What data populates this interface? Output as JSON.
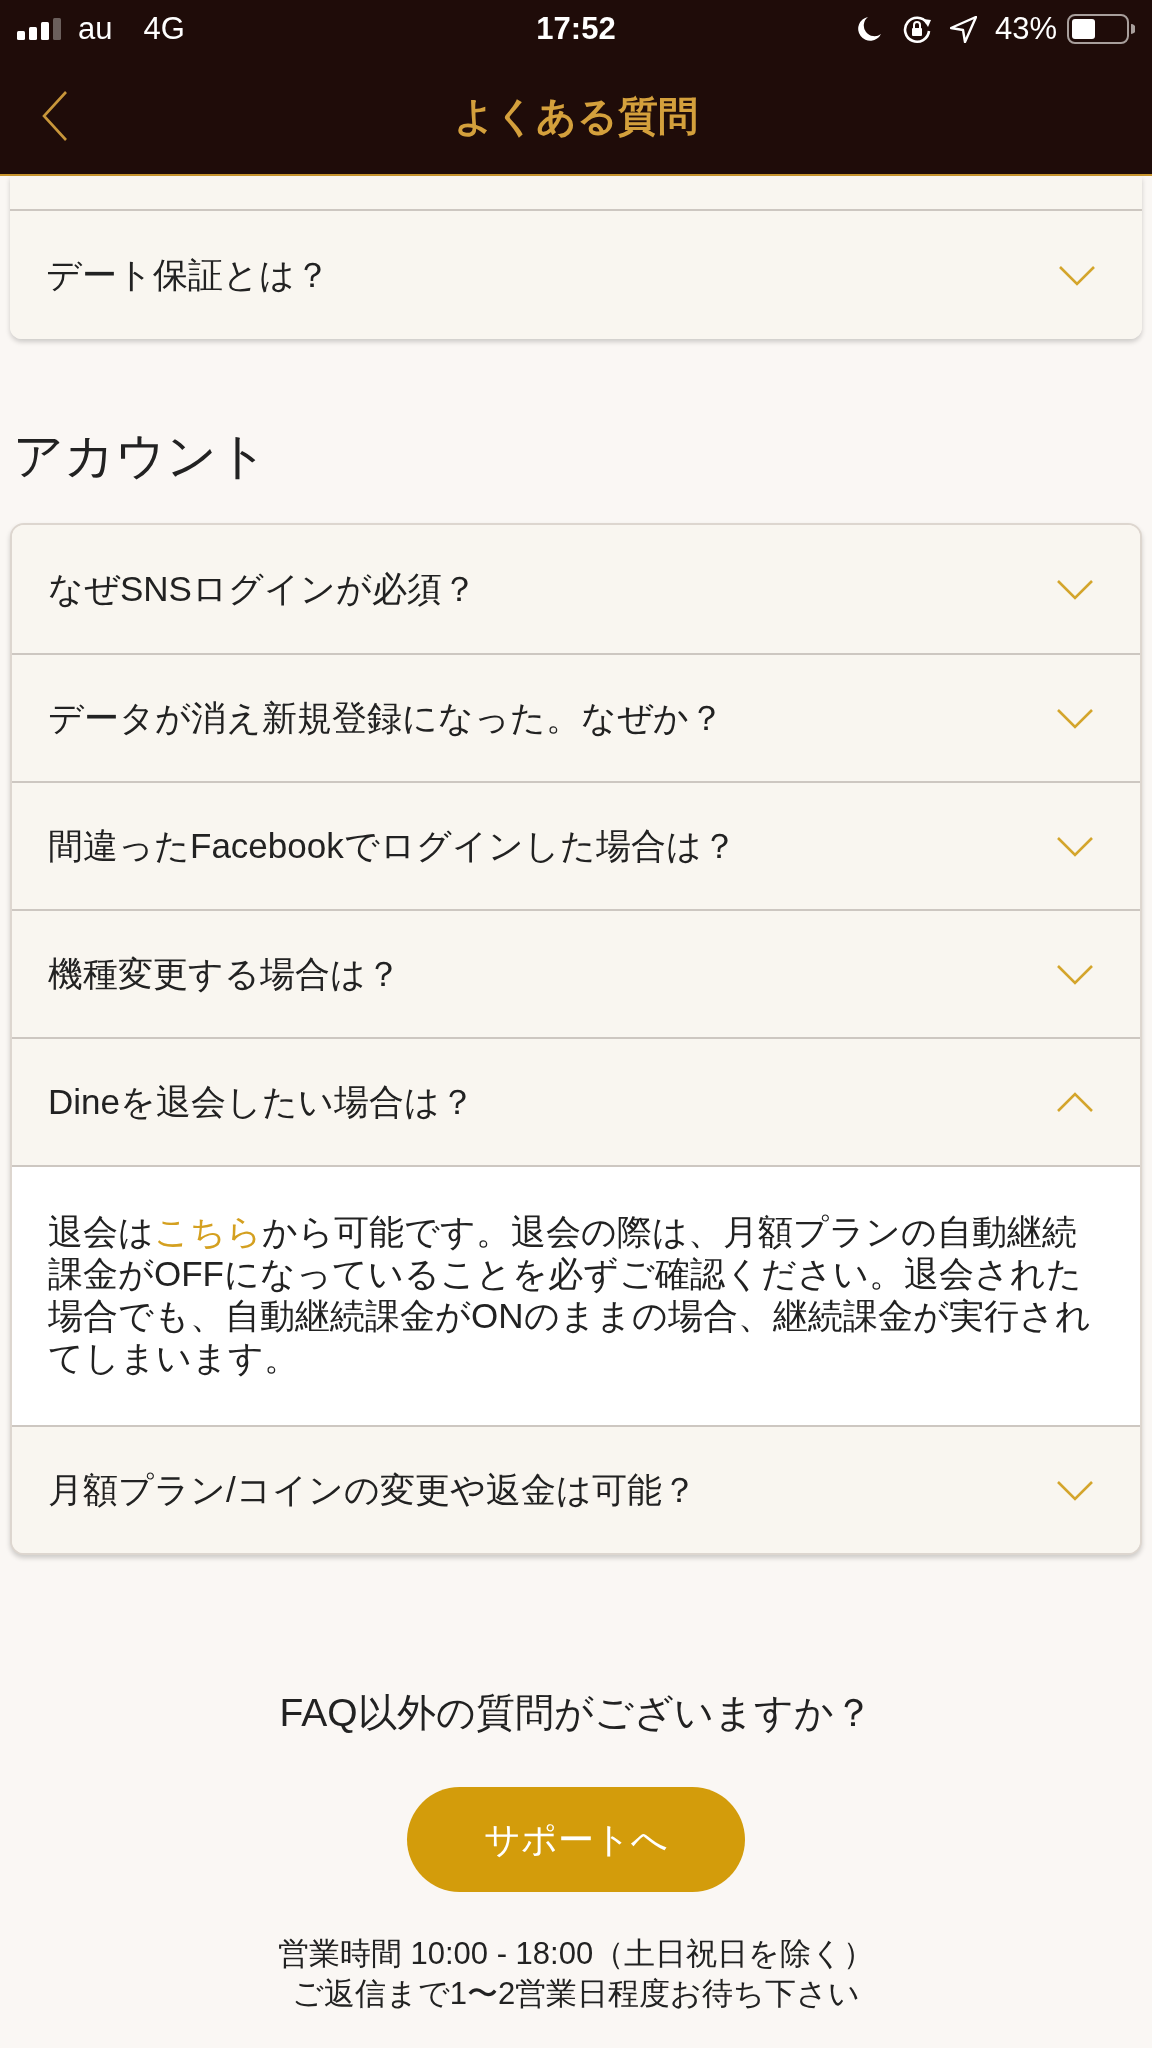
{
  "status_bar": {
    "carrier": "au",
    "network": "4G",
    "time": "17:52",
    "battery": "43%"
  },
  "nav_bar": {
    "title": "よくある質問"
  },
  "sections": [
    {
      "items": [
        {
          "question": "デート保証とは？",
          "expanded": false
        }
      ]
    },
    {
      "title": "アカウント",
      "items": [
        {
          "question": "なぜSNSログインが必須？",
          "expanded": false
        },
        {
          "question": "データが消え新規登録になった。なぜか？",
          "expanded": false
        },
        {
          "question": "間違ったFacebookでログインした場合は？",
          "expanded": false
        },
        {
          "question": "機種変更する場合は？",
          "expanded": false
        },
        {
          "question": "Dineを退会したい場合は？",
          "expanded": true,
          "answer": {
            "before": "退会は",
            "link": "こちら",
            "after": "から可能です。退会の際は、月額プランの自動継続課金がOFFになっていることを必ずご確認ください。退会された場合でも、自動継続課金がONのままの場合、継続課金が実行されてしまいます。"
          }
        },
        {
          "question": "月額プラン/コインの変更や返金は可能？",
          "expanded": false
        }
      ]
    }
  ],
  "contact": {
    "prompt": "FAQ以外の質問がございますか？",
    "button": "サポートへ",
    "hours": "営業時間 10:00 - 18:00（土日祝日を除く）",
    "note": "ご返信まで1〜2営業日程度お待ち下さい"
  }
}
